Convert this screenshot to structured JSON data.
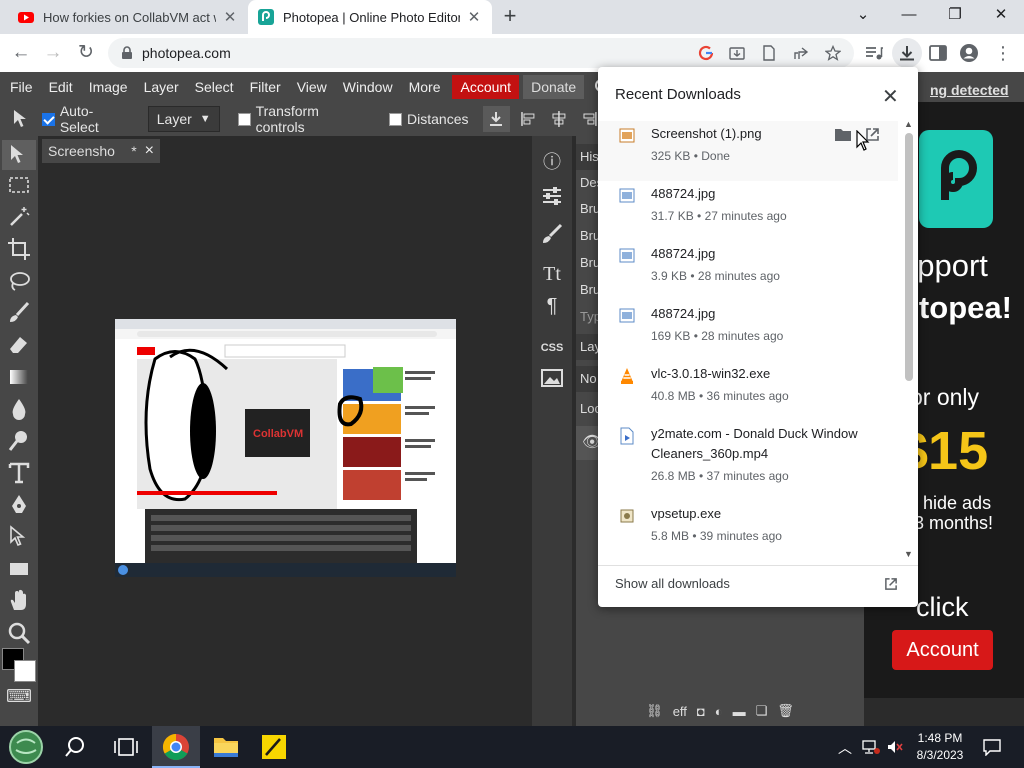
{
  "browser": {
    "tabs": [
      {
        "title": "How forkies on CollabVM act wh",
        "favicon": "youtube-icon"
      },
      {
        "title": "Photopea | Online Photo Editor",
        "favicon": "photopea-icon"
      }
    ],
    "url": "photopea.com"
  },
  "photopea": {
    "menu": [
      "File",
      "Edit",
      "Image",
      "Layer",
      "Select",
      "Filter",
      "View",
      "Window",
      "More",
      "Account",
      "Donate"
    ],
    "ad_notice": "ng detected",
    "options": {
      "auto_select_label": "Auto-Select",
      "auto_select_checked": true,
      "layer_select_value": "Layer",
      "transform_label": "Transform controls",
      "distances_label": "Distances"
    },
    "document_tab": {
      "name": "Screensho",
      "modified_mark": "*",
      "close": "×"
    },
    "right_panel_rows": [
      "His",
      "Des",
      "Bru",
      "Bru",
      "Bru",
      "Bru",
      "Typ",
      "Lay",
      "No",
      "Loc"
    ],
    "mid_labels": [
      "CSS"
    ],
    "bottom_icons_text": "eff"
  },
  "ad": {
    "line1": "upport",
    "line2": "otopea!",
    "line3": "or only",
    "price": "$15",
    "line4": "d hide ads",
    "line5": "3 months!",
    "click": "click",
    "button": "Account"
  },
  "downloads": {
    "title": "Recent Downloads",
    "items": [
      {
        "name": "Screenshot (1).png",
        "status": "325 KB • Done",
        "icon": "image-file-icon"
      },
      {
        "name": "488724.jpg",
        "status": "31.7 KB • 27 minutes ago",
        "icon": "image-file-icon"
      },
      {
        "name": "488724.jpg",
        "status": "3.9 KB • 28 minutes ago",
        "icon": "image-file-icon"
      },
      {
        "name": "488724.jpg",
        "status": "169 KB • 28 minutes ago",
        "icon": "image-file-icon"
      },
      {
        "name": "vlc-3.0.18-win32.exe",
        "status": "40.8 MB • 36 minutes ago",
        "icon": "vlc-icon"
      },
      {
        "name": "y2mate.com - Donald Duck Window Cleaners_360p.mp4",
        "status": "26.8 MB • 37 minutes ago",
        "icon": "video-file-icon"
      },
      {
        "name": "vpsetup.exe",
        "status": "5.8 MB • 39 minutes ago",
        "icon": "installer-icon"
      }
    ],
    "show_all": "Show all downloads"
  },
  "taskbar": {
    "time": "1:48 PM",
    "date": "8/3/2023"
  }
}
